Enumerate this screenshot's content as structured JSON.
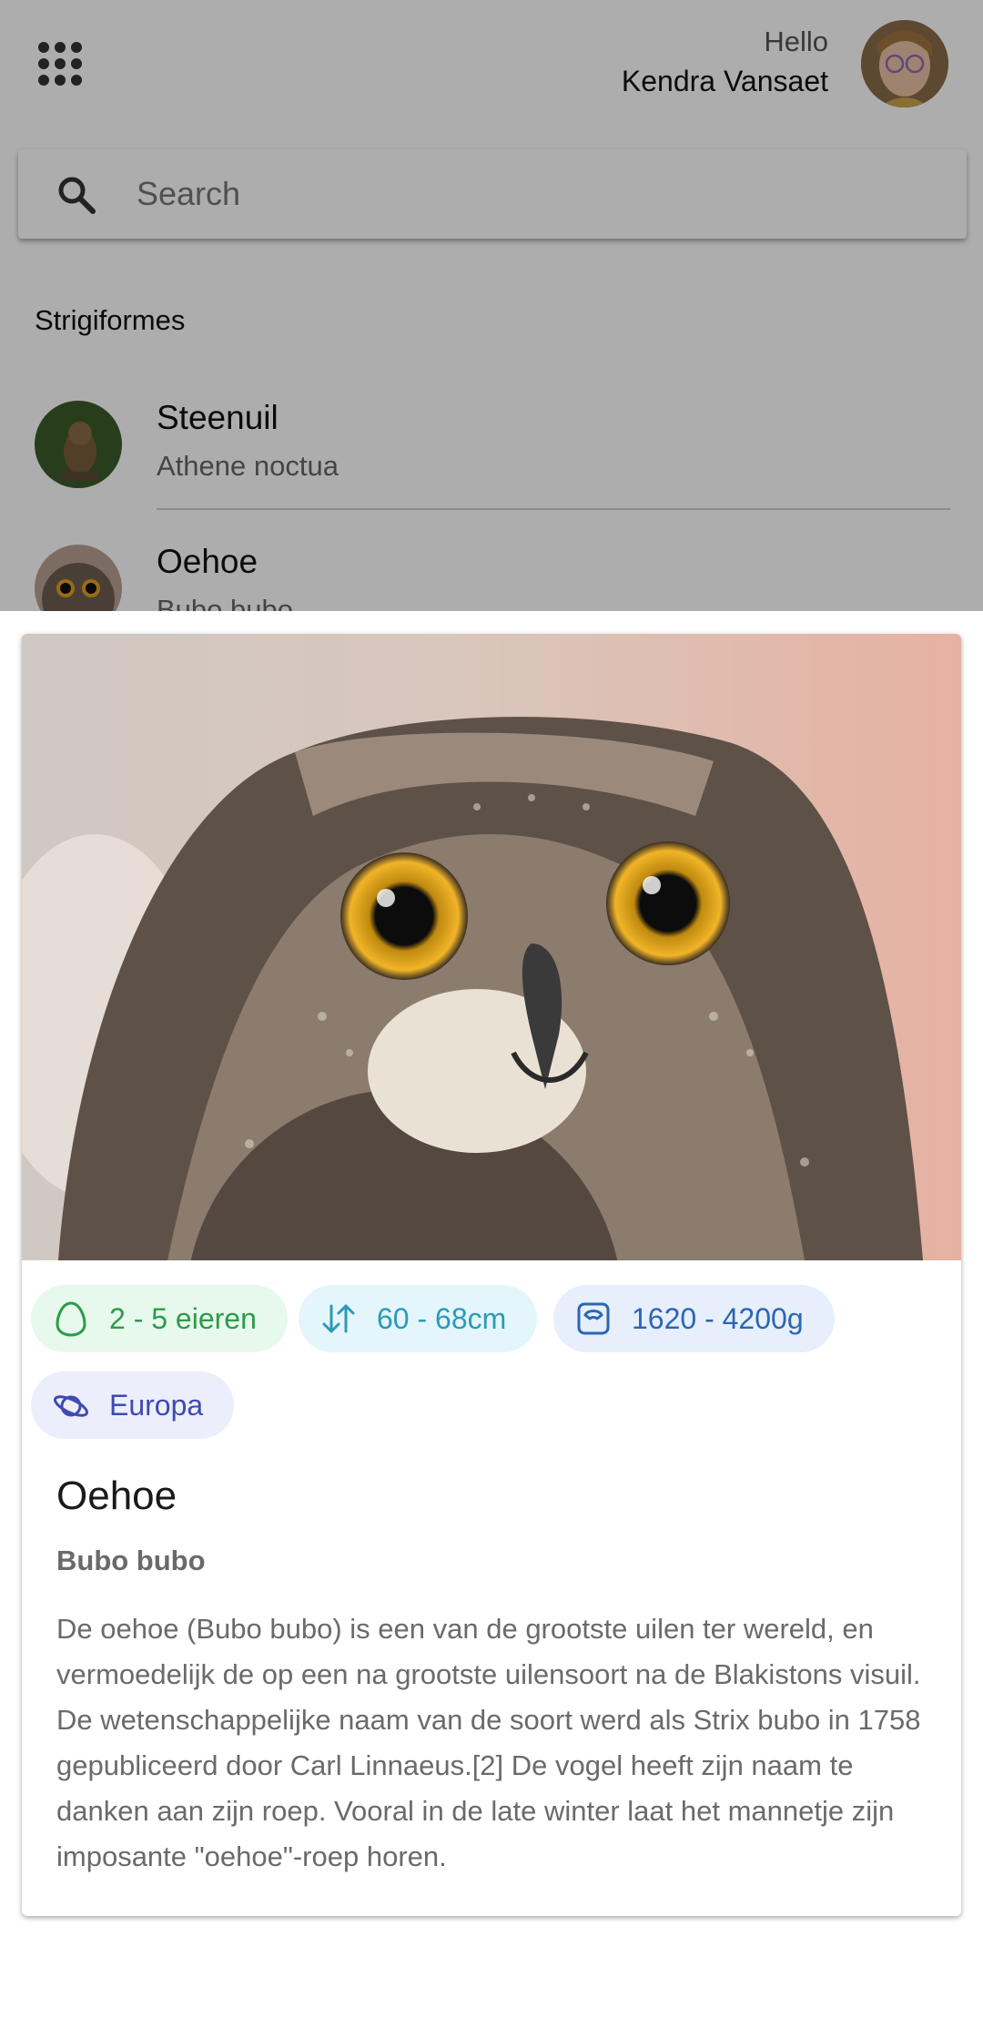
{
  "header": {
    "greeting": "Hello",
    "user_name": "Kendra Vansaet"
  },
  "search": {
    "placeholder": "Search"
  },
  "list": {
    "section_title": "Strigiformes",
    "items": [
      {
        "name": "Steenuil",
        "latin": "Athene noctua"
      },
      {
        "name": "Oehoe",
        "latin": "Bubo bubo"
      }
    ]
  },
  "detail": {
    "eggs": "2 - 5 eieren",
    "size": "60 - 68cm",
    "weight": "1620 - 4200g",
    "region": "Europa",
    "title": "Oehoe",
    "subtitle": "Bubo bubo",
    "description": "De oehoe (Bubo bubo) is een van de grootste uilen ter wereld, en vermoedelijk de op een na grootste uilensoort na de Blakistons visuil. De wetenschappelijke naam van de soort werd als Strix bubo in 1758 gepubliceerd door Carl Linnaeus.[2] De vogel heeft zijn naam te danken aan zijn roep. Vooral in de late winter laat het mannetje zijn imposante \"oehoe\"-roep horen."
  },
  "colors": {
    "eggs_chip": "#2c9c4a",
    "size_chip": "#2c9ab6",
    "weight_chip": "#2c66b0",
    "region_chip": "#3f4ab2"
  }
}
